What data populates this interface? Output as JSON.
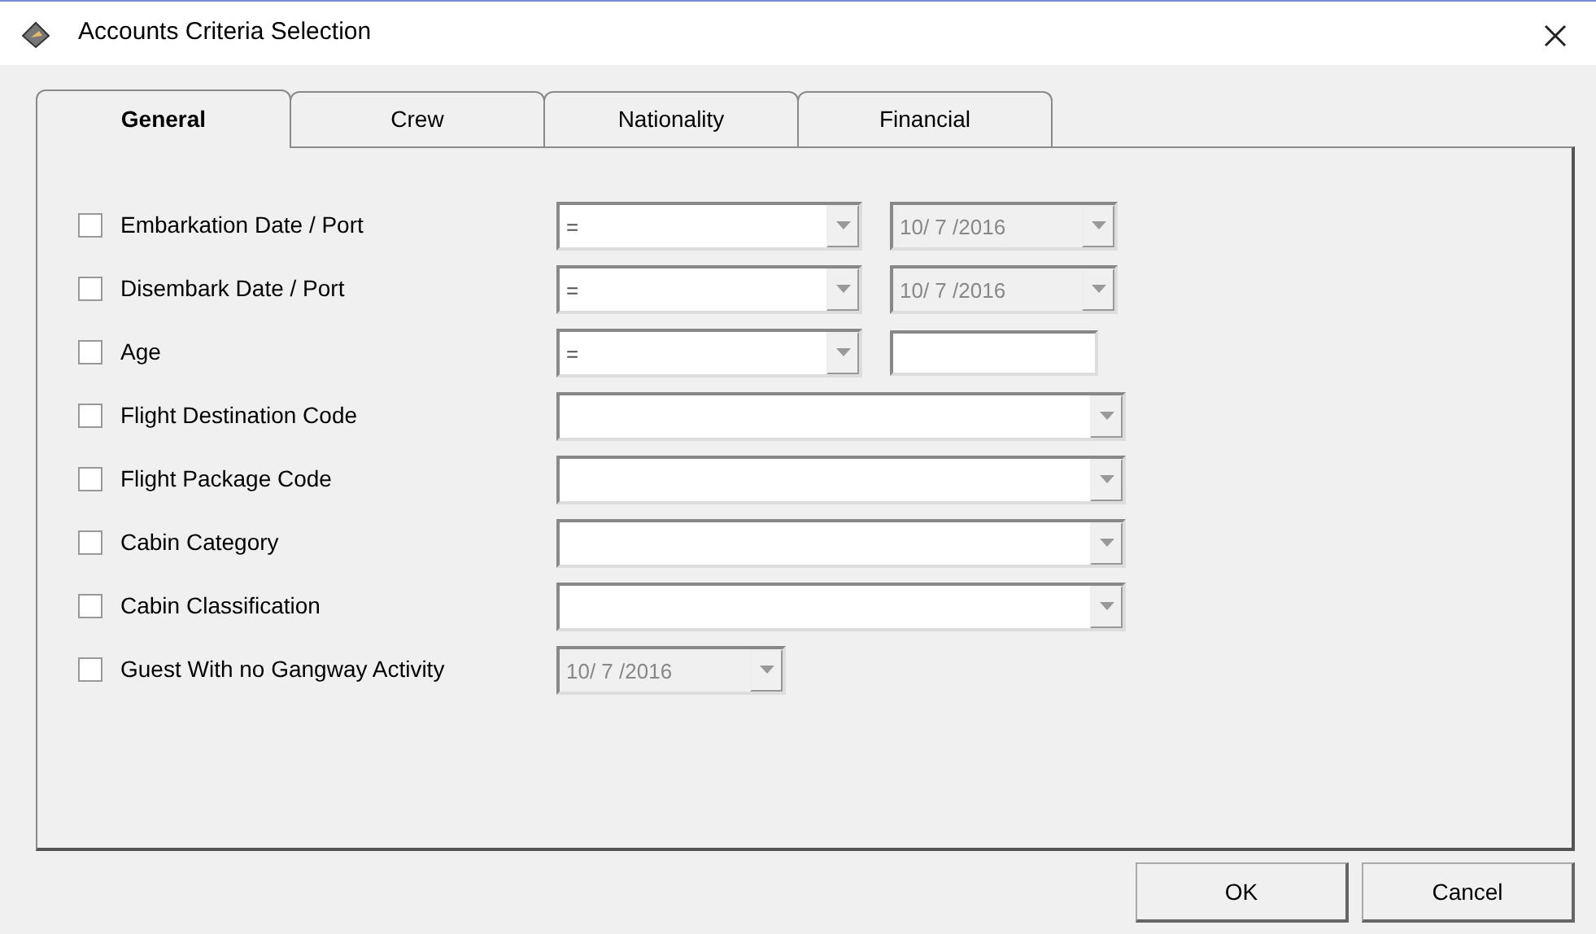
{
  "window": {
    "title": "Accounts Criteria Selection"
  },
  "tabs": [
    {
      "label": "General",
      "selected": true
    },
    {
      "label": "Crew",
      "selected": false
    },
    {
      "label": "Nationality",
      "selected": false
    },
    {
      "label": "Financial",
      "selected": false
    }
  ],
  "criteria": [
    {
      "kind": "operator_date",
      "label": "Embarkation Date / Port",
      "checked": false,
      "operator": "=",
      "date": "10/ 7 /2016"
    },
    {
      "kind": "operator_date",
      "label": "Disembark Date / Port",
      "checked": false,
      "operator": "=",
      "date": "10/ 7 /2016"
    },
    {
      "kind": "operator_text",
      "label": "Age",
      "checked": false,
      "operator": "="
    },
    {
      "kind": "combo",
      "label": "Flight Destination Code",
      "checked": false
    },
    {
      "kind": "combo",
      "label": "Flight Package Code",
      "checked": false
    },
    {
      "kind": "combo",
      "label": "Cabin Category",
      "checked": false
    },
    {
      "kind": "combo",
      "label": "Cabin Classification",
      "checked": false
    },
    {
      "kind": "date",
      "label": "Guest With no Gangway Activity",
      "checked": false,
      "date": "10/ 7 /2016"
    }
  ],
  "buttons": [
    {
      "label": "OK"
    },
    {
      "label": "Cancel"
    }
  ]
}
